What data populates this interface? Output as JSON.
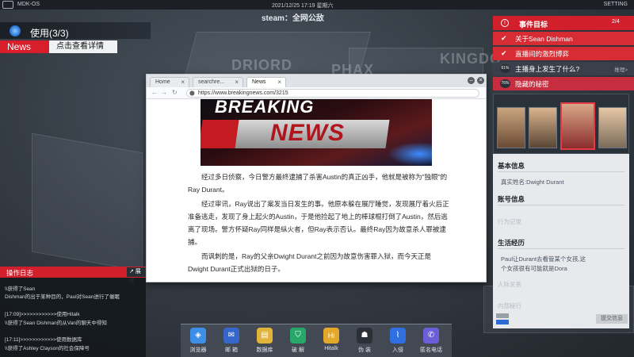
{
  "topbar": {
    "os_name": "MDK-OS",
    "datetime": "2021/12/25   17:19   星期六",
    "setting": "SETTING"
  },
  "notice": "steam：全网公敌",
  "map_labels": [
    "DRIORD",
    "PHAX",
    "KINGDO"
  ],
  "usage": {
    "text": "使用(3/3)"
  },
  "news": {
    "tag": "News",
    "detail": "点击查看详情"
  },
  "browser": {
    "tabs": [
      {
        "label": "Home",
        "close": "×"
      },
      {
        "label": "searchre...",
        "close": "×"
      },
      {
        "label": "News",
        "close": "×"
      }
    ],
    "url": "https://www.breakingnews.com/3215",
    "banner": {
      "breaking": "BREAKING",
      "news": "NEWS"
    },
    "article": [
      "经过多日侦察，今日警方最终逮捕了杀害Austin的真正凶手，他就是被称为\"独眼\"的Ray Durant。",
      "经过审讯，Ray说出了案发当日发生的事。他原本躲在展厅睡觉，发现展厅着火后正准备逃走，发现了身上起火的Austin，于是他捡起了地上的棒球棍打倒了Austin，然后逃离了现场。警方怀疑Ray同样是纵火者，但Ray表示否认。最终Ray因为故意杀人罪被逮捕。",
      "而讽刺的是，Ray的父亲Dwight Durant之前因为故意伤害罪入狱，而今天正是Dwight Durant正式出狱的日子。"
    ]
  },
  "events": {
    "title": "事件目标",
    "page": "2/4",
    "items": [
      {
        "label": "关于Sean Dishman",
        "status": "done",
        "icon": "check-icon"
      },
      {
        "label": "直播间的激烈博弈",
        "status": "done",
        "icon": "check-icon"
      },
      {
        "label": "主播身上发生了什么?",
        "status": "progress",
        "pct": "61%",
        "side": "推理>"
      },
      {
        "label": "隐藏的秘密",
        "status": "progress",
        "pct": "76%"
      }
    ]
  },
  "profile": {
    "basic_title": "基本信息",
    "basic_item": "真实姓名:Dwight Durant",
    "account_title": "账号信息",
    "account_faded": "行为记录",
    "life_title": "生活经历",
    "life_item_1": "Paul让Durant去看管某个女孩,这",
    "life_item_2": "个女孩很有可能就是Dora",
    "life_faded_1": "人际关系",
    "life_faded_2": "内部秘行",
    "submit": "提交信息",
    "tiny_buttons": [
      "",
      ""
    ]
  },
  "log": {
    "title": "操作日志",
    "expand": "↗ 展开",
    "lines": [
      "\\\\获得了Sean",
      "Dishman的出于某种目的，Paul对Sean进行了催眠",
      "[17:09]>>>>>>>>>>>>使用Hitalk",
      "\\\\获得了Sean Dishman的从Van的聊天中得知",
      "[17:11]>>>>>>>>>>>>使用数据库",
      "\\\\获得了Ashley Clayson的社会保障号"
    ]
  },
  "dock": [
    {
      "label": "浏览器",
      "icon": "browser-icon",
      "color": "#3d8ee6",
      "glyph": "◈"
    },
    {
      "label": "邮 箱",
      "icon": "mail-icon",
      "color": "#3566c9",
      "glyph": "✉"
    },
    {
      "label": "数据库",
      "icon": "database-icon",
      "color": "#e2b33a",
      "glyph": "▤"
    },
    {
      "label": "破 解",
      "icon": "crack-icon",
      "color": "#27a86a",
      "glyph": "⛉"
    },
    {
      "label": "Hitalk",
      "icon": "hitalk-icon",
      "color": "#e3a82b",
      "glyph": "Hi"
    },
    {
      "label": "伪 装",
      "icon": "disguise-icon",
      "color": "#2b2f36",
      "glyph": "☗"
    },
    {
      "label": "入侵",
      "icon": "hack-icon",
      "color": "#2f6fe0",
      "glyph": "⌇"
    },
    {
      "label": "匿名电话",
      "icon": "phone-icon",
      "color": "#6a5fd8",
      "glyph": "✆"
    }
  ]
}
